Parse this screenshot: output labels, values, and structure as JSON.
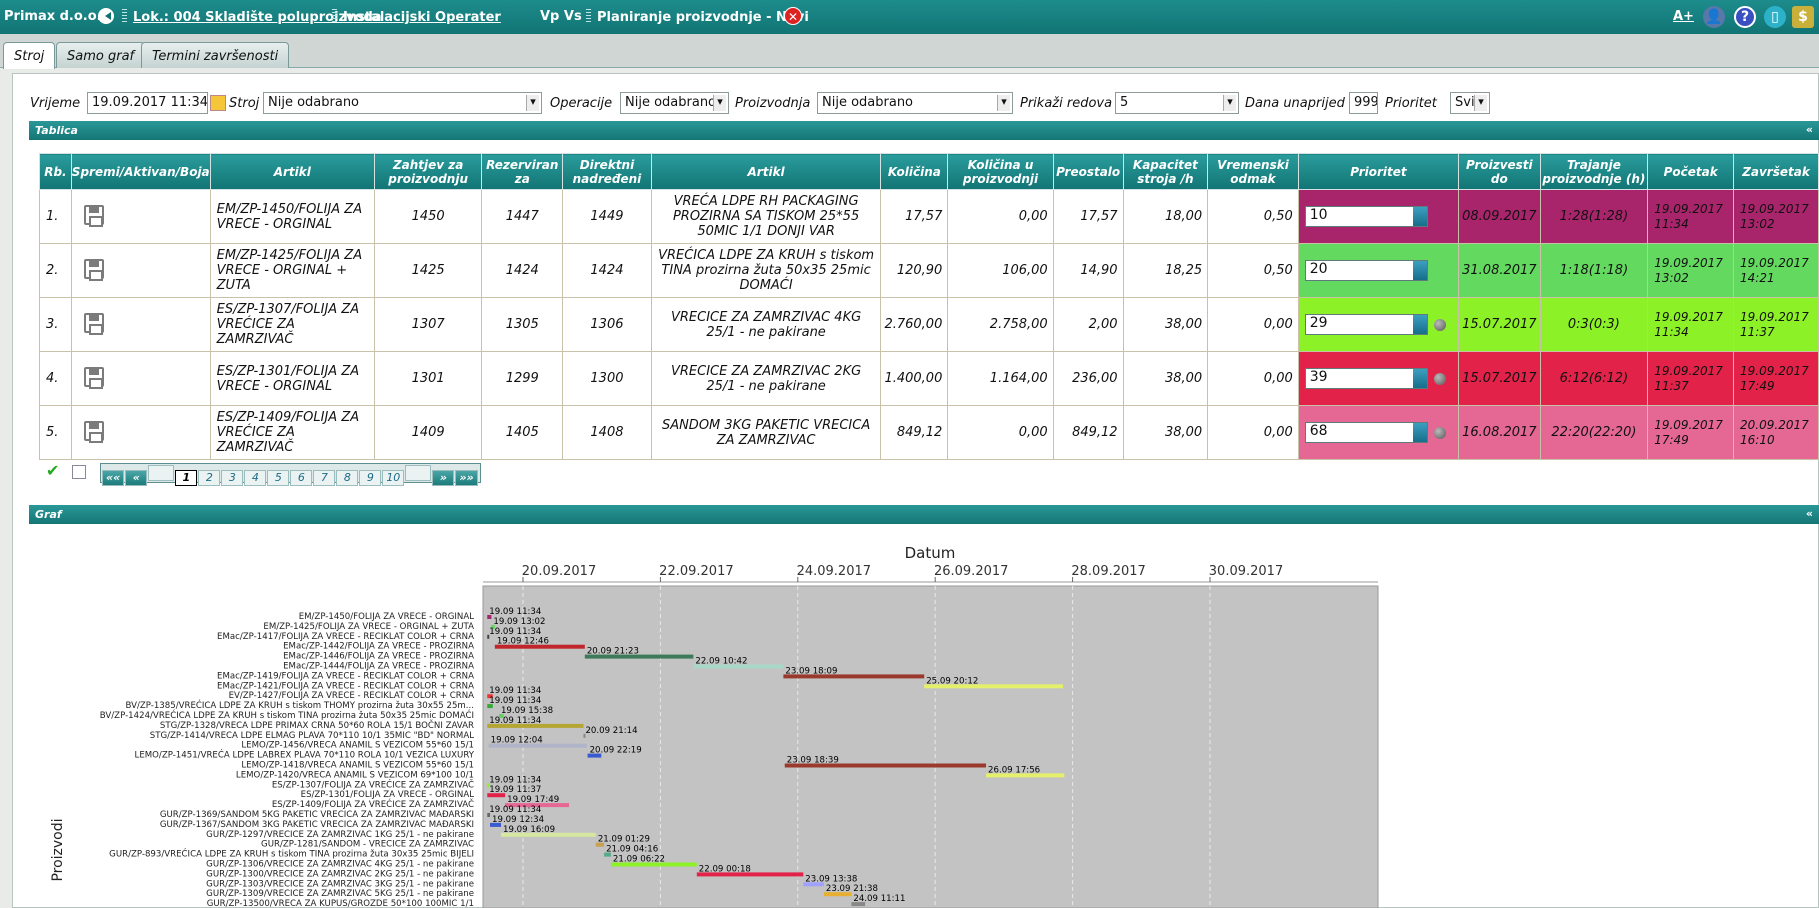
{
  "topbar": {
    "company": "Primax d.o.o.",
    "location": "Lok.: 004 Skladište poluproizvoda",
    "user": "Instalacijski Operater",
    "vp": "Vp Vs",
    "page": "Planiranje proizvodnje - Novi",
    "font_size_btn": "A+"
  },
  "tabs": [
    "Stroj",
    "Samo graf",
    "Termini završenosti"
  ],
  "filters": {
    "vrijeme_label": "Vrijeme",
    "vrijeme": "19.09.2017 11:34",
    "stroj_label": "Stroj",
    "stroj": "Nije odabrano",
    "operacije_label": "Operacije",
    "operacije": "Nije odabrano",
    "proizvodnja_label": "Proizvodnja",
    "proizvodnja": "Nije odabrano",
    "prikazi_label": "Prikaži redova",
    "prikazi": "5",
    "dana_label": "Dana unaprijed",
    "dana": "999",
    "prioritet_label": "Prioritet",
    "prioritet": "Svi"
  },
  "table_section": "Tablica",
  "graf_section": "Graf",
  "collapse_symbol": "«",
  "columns": [
    "Rb.",
    "Spremi/Aktivan/Boja",
    "Artikl",
    "Zahtjev za proizvodnju",
    "Rezerviran za",
    "Direktni nadređeni",
    "Artikl",
    "Količina",
    "Količina u proizvodnji",
    "Preostalo",
    "Kapacitet stroja /h",
    "Vremenski odmak",
    "Prioritet",
    "Proizvesti do",
    "Trajanje proizvodnje (h)",
    "Početak",
    "Završetak"
  ],
  "rows": [
    {
      "rb": "1.",
      "artikl": "EM/ZP-1450/FOLIJA ZA VRECE - ORGINAL",
      "zahtjev": "1450",
      "rezerviran": "1447",
      "nadredeni": "1449",
      "artikl2": "VREĆA LDPE RH PACKAGING PROZIRNA SA TISKOM 25*55 50MIC 1/1 DONJI VAR",
      "kolicina": "17,57",
      "kol_proizv": "0,00",
      "preostalo": "17,57",
      "kapacitet": "18,00",
      "odmak": "0,50",
      "prioritet": "10",
      "ball": false,
      "proizvesti_do": "08.09.2017",
      "trajanje": "1:28(1:28)",
      "pocetak": "19.09.2017 11:34",
      "zavrsetak": "19.09.2017 13:02",
      "color": "#a8246b"
    },
    {
      "rb": "2.",
      "artikl": "EM/ZP-1425/FOLIJA ZA VRECE - ORGINAL + ZUTA",
      "zahtjev": "1425",
      "rezerviran": "1424",
      "nadredeni": "1424",
      "artikl2": "VREĆICA LDPE ZA KRUH s tiskom TINA prozirna žuta 50x35 25mic DOMAĆI",
      "kolicina": "120,90",
      "kol_proizv": "106,00",
      "preostalo": "14,90",
      "kapacitet": "18,25",
      "odmak": "0,50",
      "prioritet": "20",
      "ball": false,
      "proizvesti_do": "31.08.2017",
      "trajanje": "1:18(1:18)",
      "pocetak": "19.09.2017 13:02",
      "zavrsetak": "19.09.2017 14:21",
      "color": "#64d95f"
    },
    {
      "rb": "3.",
      "artikl": "ES/ZP-1307/FOLIJA ZA VREĆICE ZA ZAMRZIVAČ",
      "zahtjev": "1307",
      "rezerviran": "1305",
      "nadredeni": "1306",
      "artikl2": "VRECICE ZA ZAMRZIVAC 4KG 25/1 - ne pakirane",
      "kolicina": "2.760,00",
      "kol_proizv": "2.758,00",
      "preostalo": "2,00",
      "kapacitet": "38,00",
      "odmak": "0,00",
      "prioritet": "29",
      "ball": true,
      "proizvesti_do": "15.07.2017",
      "trajanje": "0:3(0:3)",
      "pocetak": "19.09.2017 11:34",
      "zavrsetak": "19.09.2017 11:37",
      "color": "#8cf227"
    },
    {
      "rb": "4.",
      "artikl": "ES/ZP-1301/FOLIJA ZA VRECE - ORGINAL",
      "zahtjev": "1301",
      "rezerviran": "1299",
      "nadredeni": "1300",
      "artikl2": "VRECICE ZA ZAMRZIVAC 2KG 25/1 - ne pakirane",
      "kolicina": "1.400,00",
      "kol_proizv": "1.164,00",
      "preostalo": "236,00",
      "kapacitet": "38,00",
      "odmak": "0,00",
      "prioritet": "39",
      "ball": true,
      "proizvesti_do": "15.07.2017",
      "trajanje": "6:12(6:12)",
      "pocetak": "19.09.2017 11:37",
      "zavrsetak": "19.09.2017 17:49",
      "color": "#e22249"
    },
    {
      "rb": "5.",
      "artikl": "ES/ZP-1409/FOLIJA ZA VREĆICE ZA ZAMRZIVAČ",
      "zahtjev": "1409",
      "rezerviran": "1405",
      "nadredeni": "1408",
      "artikl2": "SANDOM 3KG PAKETIC VRECICA ZA ZAMRZIVAC",
      "kolicina": "849,12",
      "kol_proizv": "0,00",
      "preostalo": "849,12",
      "kapacitet": "38,00",
      "odmak": "0,00",
      "prioritet": "68",
      "ball": true,
      "proizvesti_do": "16.08.2017",
      "trajanje": "22:20(22:20)",
      "pocetak": "19.09.2017 17:49",
      "zavrsetak": "20.09.2017 16:10",
      "color": "#e56794"
    }
  ],
  "pager": {
    "first": "««",
    "prev": "«",
    "pages": [
      "1",
      "2",
      "3",
      "4",
      "5",
      "6",
      "7",
      "8",
      "9",
      "10"
    ],
    "current": "1",
    "next": "»",
    "last": "»»"
  },
  "chart_data": {
    "type": "gantt",
    "title": "Datum",
    "ylabel": "Proizvodi",
    "x_ticks": [
      "20.09.2017",
      "22.09.2017",
      "24.09.2017",
      "26.09.2017",
      "28.09.2017",
      "30.09.2017"
    ],
    "bars": [
      {
        "label": "EM/ZP-1450/FOLIJA ZA VRECE - ORGINAL",
        "start": 0.0,
        "end": 0.06,
        "color": "#a8246b",
        "text": "19.09 11:34"
      },
      {
        "label": "EM/ZP-1425/FOLIJA ZA VRECE - ORGINAL + ZUTA",
        "start": 0.06,
        "end": 0.11,
        "color": "#64d95f",
        "text": "19.09 13:02"
      },
      {
        "label": "EMac/ZP-1417/FOLIJA ZA VRECE - RECIKLAT COLOR + CRNA",
        "start": 0.0,
        "end": 0.0,
        "color": "#444",
        "text": "19.09 11:34"
      },
      {
        "label": "EMac/ZP-1442/FOLIJA ZA VRECE - PROZIRNA",
        "start": 0.11,
        "end": 1.42,
        "color": "#c0272d",
        "text": "19.09 12:46"
      },
      {
        "label": "EMac/ZP-1446/FOLIJA ZA VRECE - PROZIRNA",
        "start": 1.42,
        "end": 3.0,
        "color": "#3d7a5a",
        "text": "20.09 21:23"
      },
      {
        "label": "EMac/ZP-1444/FOLIJA ZA VRECE - PROZIRNA",
        "start": 3.0,
        "end": 4.31,
        "color": "#a8d8c8",
        "text": "22.09 10:42"
      },
      {
        "label": "EMac/ZP-1419/FOLIJA ZA VRECE - RECIKLAT COLOR + CRNA",
        "start": 4.31,
        "end": 6.36,
        "color": "#9b3a2c",
        "text": "23.09 18:09"
      },
      {
        "label": "EMac/ZP-1421/FOLIJA ZA VRECE - RECIKLAT COLOR + CRNA",
        "start": 6.36,
        "end": 8.38,
        "color": "#e4f06a",
        "text": "25.09 20:12"
      },
      {
        "label": "EV/ZP-1427/FOLIJA ZA VRECE - RECIKLAT COLOR + CRNA",
        "start": 0.0,
        "end": 0.08,
        "color": "#e33",
        "text": "19.09 11:34"
      },
      {
        "label": "BV/ZP-1385/VREĆICA LDPE ZA KRUH s tiskom THOMY prozirna žuta 30x55 25m...",
        "start": 0.0,
        "end": 0.08,
        "color": "#3a3",
        "text": "19.09 11:34"
      },
      {
        "label": "BV/ZP-1424/VREĆICA LDPE ZA KRUH s tiskom TINA prozirna žuta 50x35 25mic DOMAĆI",
        "start": 0.17,
        "end": 0.24,
        "color": "#6c6",
        "text": "19.09 15:38"
      },
      {
        "label": "STG/ZP-1328/VRECA LDPE PRIMAX CRNA 50*60 ROLA 15/1 BOČNI ZAVAR",
        "start": 0.0,
        "end": 1.4,
        "color": "#b5a532",
        "text": "19.09 11:34"
      },
      {
        "label": "STG/ZP-1414/VRECA LDPE ELMAG PLAVA 70*110 10/1 35MIC \"BD\" NORMAL",
        "start": 1.4,
        "end": 1.4,
        "color": "#888",
        "text": "20.09 21:14"
      },
      {
        "label": "LEMO/ZP-1456/VRECA ANAMIL S VEZICOM 55*60 15/1",
        "start": 0.02,
        "end": 1.45,
        "color": "#b0b4c8",
        "text": "19.09 12:04"
      },
      {
        "label": "LEMO/ZP-1451/VREĆA LDPE LABREX PLAVA 70*110 ROLA 10/1 VEZICA LUXURY",
        "start": 1.46,
        "end": 1.66,
        "color": "#3a5ad0",
        "text": "20.09 22:19"
      },
      {
        "label": "LEMO/ZP-1418/VRECA ANAMIL S VEZICOM 55*60 15/1",
        "start": 4.33,
        "end": 7.26,
        "color": "#9b3a2c",
        "text": "23.09 18:39"
      },
      {
        "label": "LEMO/ZP-1420/VRECA ANAMIL S VEZICOM 69*100 10/1",
        "start": 7.26,
        "end": 8.4,
        "color": "#e4f06a",
        "text": "26.09 17:56"
      },
      {
        "label": "ES/ZP-1307/FOLIJA ZA VREĆICE ZA ZAMRZIVAČ",
        "start": 0.0,
        "end": 0.0,
        "color": "#8cf227",
        "text": "19.09 11:34"
      },
      {
        "label": "ES/ZP-1301/FOLIJA ZA VRECE - ORGINAL",
        "start": 0.0,
        "end": 0.26,
        "color": "#e22249",
        "text": "19.09 11:37"
      },
      {
        "label": "ES/ZP-1409/FOLIJA ZA VREĆICE ZA ZAMRZIVAČ",
        "start": 0.26,
        "end": 1.19,
        "color": "#e56794",
        "text": "19.09 17:49"
      },
      {
        "label": "GUR/ZP-1369/SANDOM 5KG PAKETIC VRECICA ZA ZAMRZIVAC MAĐARSKI",
        "start": 0.0,
        "end": 0.04,
        "color": "#666",
        "text": "19.09 11:34"
      },
      {
        "label": "GUR/ZP-1367/SANDOM 3KG PAKETIC VRECICA ZA ZAMRZIVAC MAĐARSKI",
        "start": 0.04,
        "end": 0.2,
        "color": "#3a5ad0",
        "text": "19.09 12:34"
      },
      {
        "label": "GUR/ZP-1297/VRECICE ZA ZAMRZIVAC 1KG 25/1 - ne pakirane",
        "start": 0.2,
        "end": 1.58,
        "color": "#d6e8a0",
        "text": "19.09 16:09"
      },
      {
        "label": "GUR/ZP-1281/SANDOM - VRECICE ZA ZAMRZIVAC",
        "start": 1.58,
        "end": 1.7,
        "color": "#c8a050",
        "text": "21.09 01:29"
      },
      {
        "label": "GUR/ZP-893/VREĆICA LDPE ZA KRUH s tiskom TINA prozirna žuta 30x35 25mic BIJELI",
        "start": 1.7,
        "end": 1.8,
        "color": "#5a8",
        "text": "21.09 04:16"
      },
      {
        "label": "GUR/ZP-1306/VRECICE ZA ZAMRZIVAC 4KG 25/1 - ne pakirane",
        "start": 1.8,
        "end": 3.05,
        "color": "#8cf227",
        "text": "21.09 06:22"
      },
      {
        "label": "GUR/ZP-1300/VRECICE ZA ZAMRZIVAC 2KG 25/1 - ne pakirane",
        "start": 3.05,
        "end": 4.6,
        "color": "#e22249",
        "text": "22.09 00:18"
      },
      {
        "label": "GUR/ZP-1303/VRECICE ZA ZAMRZIVAC 3KG 25/1 - ne pakirane",
        "start": 4.6,
        "end": 4.9,
        "color": "#a0a0ff",
        "text": "23.09 13:38"
      },
      {
        "label": "GUR/ZP-1309/VRECICE ZA ZAMRZIVAC 5KG 25/1 - ne pakirane",
        "start": 4.9,
        "end": 5.3,
        "color": "#e8b030",
        "text": "23.09 21:38"
      },
      {
        "label": "GUR/ZP-13500/VRECA ZA KUPUS/GROZDE 50*100 100MIC 1/1",
        "start": 5.3,
        "end": 5.5,
        "color": "#888",
        "text": "24.09 11:11"
      }
    ]
  }
}
